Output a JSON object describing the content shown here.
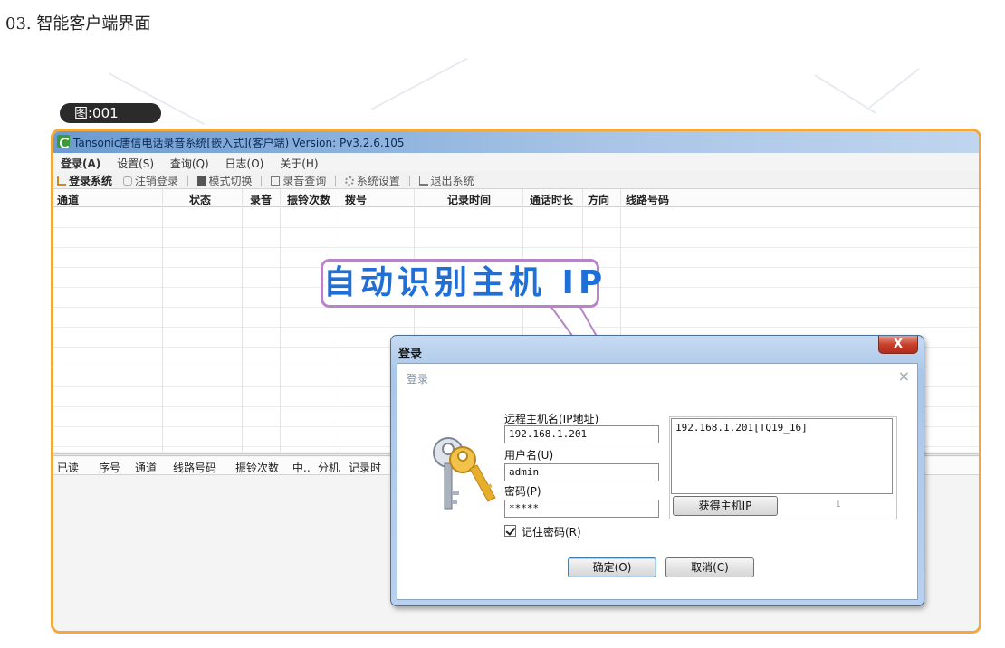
{
  "heading": "03. 智能客户端界面",
  "figure_label": "图:001",
  "app": {
    "title": "Tansonic唐信电话录音系统[嵌入式](客户端) Version: Pv3.2.6.105",
    "menu": [
      "登录(A)",
      "设置(S)",
      "查询(Q)",
      "日志(O)",
      "关于(H)"
    ],
    "toolbar": [
      {
        "label": "登录系统",
        "icon": "login-icon"
      },
      {
        "label": "注销登录",
        "icon": "logout-icon"
      },
      {
        "label": "模式切换",
        "icon": "mode-icon"
      },
      {
        "label": "录音查询",
        "icon": "query-icon"
      },
      {
        "label": "系统设置",
        "icon": "settings-icon"
      },
      {
        "label": "退出系统",
        "icon": "exit-icon"
      }
    ],
    "columns": [
      "通道",
      "状态",
      "录音",
      "振铃次数",
      "拨号",
      "记录时间",
      "通话时长",
      "方向",
      "线路号码"
    ],
    "columns2": [
      "已读",
      "序号",
      "通道",
      "线路号码",
      "振铃次数",
      "中..",
      "分机",
      "记录时"
    ]
  },
  "callout": "自动识别主机 IP",
  "dialog": {
    "title": "登录",
    "close": "X",
    "inner_title": "登录",
    "inner_close": "×",
    "host_label": "远程主机名(IP地址)",
    "host_value": "192.168.1.201",
    "user_label": "用户名(U)",
    "user_value": "admin",
    "password_label": "密码(P)",
    "password_value": "*****",
    "remember_label": "记住密码(R)",
    "remember_checked": true,
    "host_list": [
      "192.168.1.201[TQ19_16]"
    ],
    "get_host_button": "获得主机IP",
    "page_number": "1",
    "ok_button": "确定(O)",
    "cancel_button": "取消(C)"
  },
  "colors": {
    "frame_border": "#f0a93a",
    "callout_border": "#b784c8",
    "callout_text": "#1f6fd6",
    "close_button": "#c9412d"
  }
}
